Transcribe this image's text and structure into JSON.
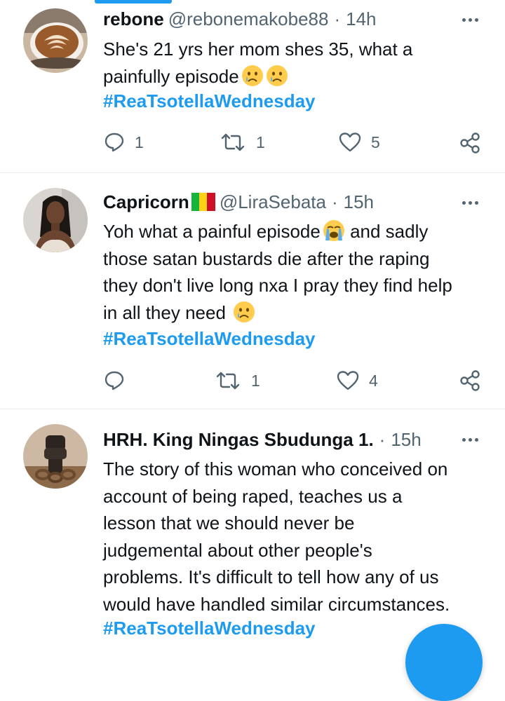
{
  "tweets": [
    {
      "name": "rebone",
      "handle": "@rebonemakobe88",
      "time": "14h",
      "lines": [
        "She's 21 yrs her mom shes 35, what a",
        "painfully episode"
      ],
      "hashtag": "#ReaTsotellaWednesday",
      "replies": "1",
      "retweets": "1",
      "likes": "5"
    },
    {
      "name": "Capricorn",
      "handle": "@LiraSebata",
      "time": "15h",
      "lines": [
        "Yoh what a painful episode",
        "and sadly",
        "those satan bustards die after the raping",
        "they don't live long nxa I pray they find help",
        "in all they need"
      ],
      "hashtag": "#ReaTsotellaWednesday",
      "replies": "",
      "retweets": "1",
      "likes": "4"
    },
    {
      "name": "HRH. King Ningas Sbudunga 1.",
      "handle": "",
      "time": "15h",
      "lines": [
        "The story of this woman who conceived on",
        "account of being raped, teaches us a",
        "lesson that we should never be",
        "judgemental about other people's",
        "problems. It's difficult to tell how any of us",
        "would have handled similar circumstances."
      ],
      "hashtag": "#ReaTsotellaWednesday"
    }
  ],
  "dot": "·",
  "icons": [
    "reply-icon",
    "retweet-icon",
    "like-icon",
    "share-icon",
    "more-icon",
    "crying-face-emoji",
    "loudly-crying-face-emoji"
  ],
  "colors": {
    "accent": "#1d9bf0",
    "muted": "#536471",
    "text": "#0f1419",
    "divider": "#e6ecf0"
  }
}
